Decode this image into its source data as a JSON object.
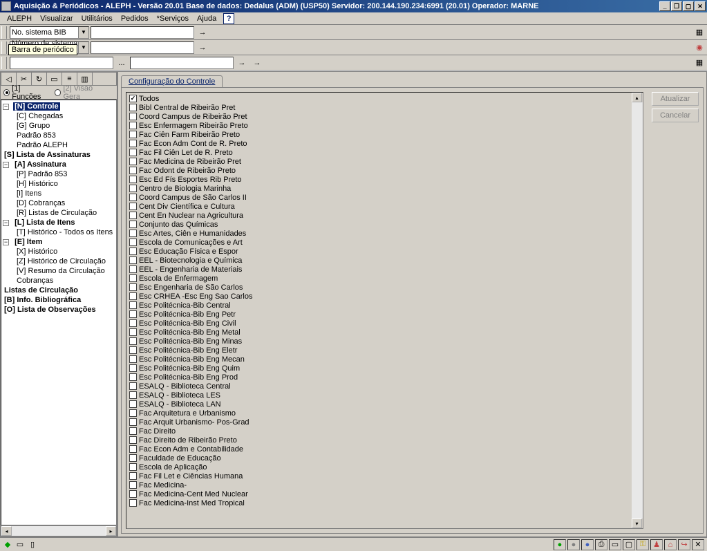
{
  "window": {
    "title": "Aquisição & Periódicos - ALEPH - Versão 20.01  Base de dados:  Dedalus (ADM) (USP50)  Servidor: 200.144.190.234:6991 (20.01) Operador: MARNE",
    "min": "_",
    "max": "▢",
    "restore": "❐",
    "close": "✕"
  },
  "menu": {
    "items": [
      "ALEPH",
      "Visualizar",
      "Utilitários",
      "Pedidos",
      "*Serviços",
      "Ajuda"
    ],
    "help": "?"
  },
  "toolbar": {
    "select1": "No. sistema BIB",
    "select2": "Número de sistema ADM",
    "go": "→",
    "ellipsis": "...",
    "tooltip": "Barra de periódico"
  },
  "left": {
    "tabs": {
      "t1": "[1] Funções",
      "t2": "[2] Visão Gera"
    },
    "tree": {
      "n_controle": "[N] Controle",
      "c_chegadas": "[C] Chegadas",
      "g_grupo": "[G] Grupo",
      "padrao_853": "Padrão 853",
      "padrao_aleph": "Padrão ALEPH",
      "s_lista_assin": "[S] Lista de Assinaturas",
      "a_assinatura": "[A] Assinatura",
      "p_padrao_853": "[P] Padrão 853",
      "h_historico": "[H] Histórico",
      "i_itens": "[I] Itens",
      "d_cobrancas": "[D] Cobranças",
      "r_listas_circ": "[R] Listas de Circulação",
      "l_lista_itens": "[L] Lista de Itens",
      "t_hist_itens": "[T] Histórico - Todos os Itens",
      "e_item": "[E] Item",
      "x_historico": "[X] Histórico",
      "z_hist_circ": "[Z] Histórico de Circulação",
      "v_resumo_circ": "[V] Resumo da Circulação",
      "cobrancas": "Cobranças",
      "listas_circ": "Listas de Circulação",
      "b_info_biblio": "[B] Info. Bibliográfica",
      "o_lista_obs": "[O] Lista de Observações"
    }
  },
  "right": {
    "tab": "Configuração do Controle",
    "todos": "Todos",
    "buttons": {
      "atualizar": "Atualizar",
      "cancelar": "Cancelar"
    },
    "items": [
      "Bibl Central de Ribeirão Pret",
      "Coord Campus de Ribeirão Pret",
      "Esc Enfermagem Ribeirão Preto",
      "Fac Ciên Farm Ribeirão Preto",
      "Fac Econ Adm Cont de R. Preto",
      "Fac Fil Ciên Let de R. Preto",
      "Fac Medicina de Ribeirão Pret",
      "Fac Odont de Ribeirão Preto",
      "Esc Ed Fís Esportes Rib Preto",
      "Centro de Biologia Marinha",
      "Coord Campus de São Carlos II",
      "Cent Div Científica e Cultura",
      "Cent En Nuclear na Agricultura",
      "Conjunto das Químicas",
      "Esc Artes, Ciên e Humanidades",
      "Escola de Comunicações e Art",
      "Esc Educação Física e Espor",
      "EEL - Biotecnologia e Química",
      "EEL - Engenharia de Materiais",
      "Escola de Enfermagem",
      "Esc Engenharia de São Carlos",
      "Esc CRHEA -Esc Eng Sao Carlos",
      "Esc Politécnica-Bib Central",
      "Esc Politécnica-Bib Eng Petr",
      "Esc Politécnica-Bib Eng Civil",
      "Esc Politécnica-Bib Eng Metal",
      "Esc Politécnica-Bib Eng Minas",
      "Esc Politécnica-Bib Eng Eletr",
      "Esc Politécnica-Bib Eng Mecan",
      "Esc Politécnica-Bib Eng Quim",
      "Esc Politécnica-Bib Eng Prod",
      "ESALQ - Biblioteca Central",
      "ESALQ - Biblioteca LES",
      "ESALQ - Biblioteca LAN",
      "Fac Arquitetura e Urbanismo",
      "Fac Arquit Urbanismo- Pos-Grad",
      "Fac Direito",
      "Fac Direito de Ribeirão Preto",
      "Fac Econ Adm e Contabilidade",
      "Faculdade de Educação",
      "Escola de Aplicação",
      "Fac Fil Let e Ciências Humana",
      "Fac Medicina-",
      "Fac Medicina-Cent Med Nuclear",
      "Fac Medicina-Inst Med Tropical"
    ]
  }
}
